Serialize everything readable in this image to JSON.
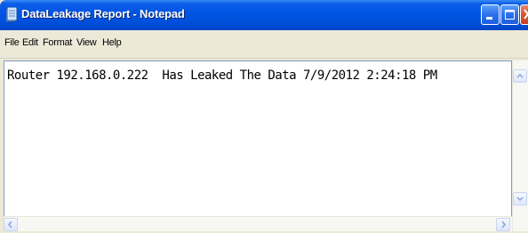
{
  "window": {
    "title": "DataLeakage Report - Notepad",
    "icon": "notepad-icon",
    "controls": [
      "minimize-icon",
      "maximize-icon",
      "close-icon"
    ]
  },
  "menu": {
    "items": [
      {
        "label": "File"
      },
      {
        "label": "Edit"
      },
      {
        "label": "Format"
      },
      {
        "label": "View"
      },
      {
        "label": "Help"
      }
    ]
  },
  "document": {
    "lines": [
      "Router 192.168.0.222  Has Leaked The Data 7/9/2012 2:24:18 PM"
    ]
  },
  "colors": {
    "titlebar": "#0054e3",
    "menubar": "#ece9d8",
    "editor_bg": "#ffffff",
    "close_button": "#d8542e"
  }
}
